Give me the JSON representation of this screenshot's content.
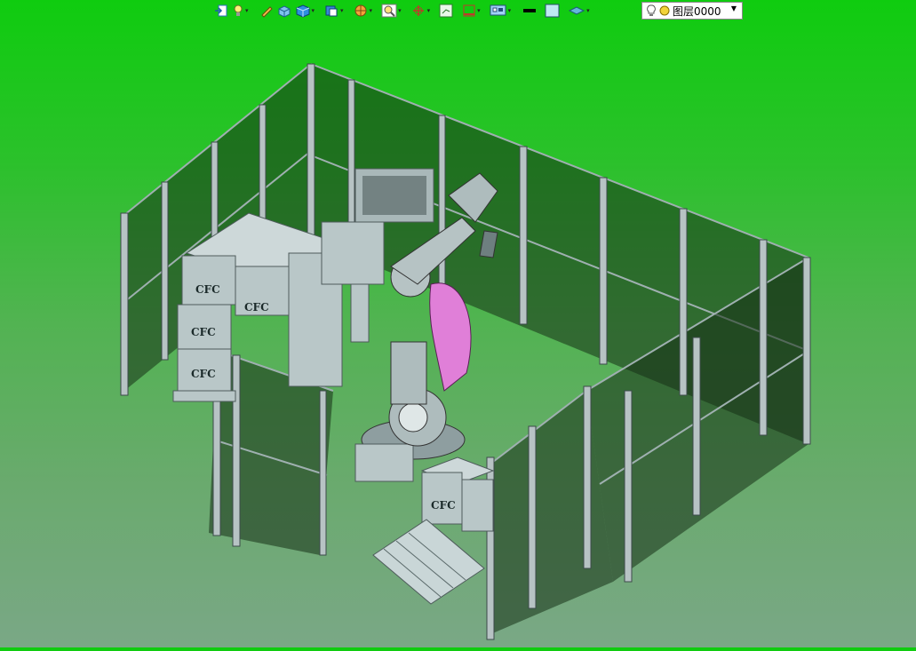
{
  "toolbar": {
    "icons": [
      {
        "name": "import-icon"
      },
      {
        "name": "light-bulb-icon",
        "dropdown": true
      },
      {
        "name": "pen-icon"
      },
      {
        "name": "shaded-cube-icon"
      },
      {
        "name": "blue-cube-icon",
        "dropdown": true
      },
      {
        "name": "view-cube-icon",
        "dropdown": true
      },
      {
        "name": "render-style-icon",
        "dropdown": true
      },
      {
        "name": "zoom-icon",
        "dropdown": true
      },
      {
        "name": "axis-icon",
        "dropdown": true
      },
      {
        "name": "measure-icon"
      },
      {
        "name": "section-icon",
        "dropdown": true
      },
      {
        "name": "display-settings-icon",
        "dropdown": true
      },
      {
        "name": "line-color-icon"
      },
      {
        "name": "fill-color-icon"
      },
      {
        "name": "layer-properties-icon",
        "dropdown": true
      }
    ],
    "layer": {
      "label": "图层0000",
      "bulb_icon": "bulb-icon",
      "state_icon": "layer-on-icon"
    }
  },
  "scene": {
    "box_label": "CFC",
    "colors": {
      "bg_top": "#0fcc0f",
      "bg_bottom": "#7aa886",
      "robot_arm": "#e07fd8",
      "metal": "#b7c3c4"
    }
  }
}
